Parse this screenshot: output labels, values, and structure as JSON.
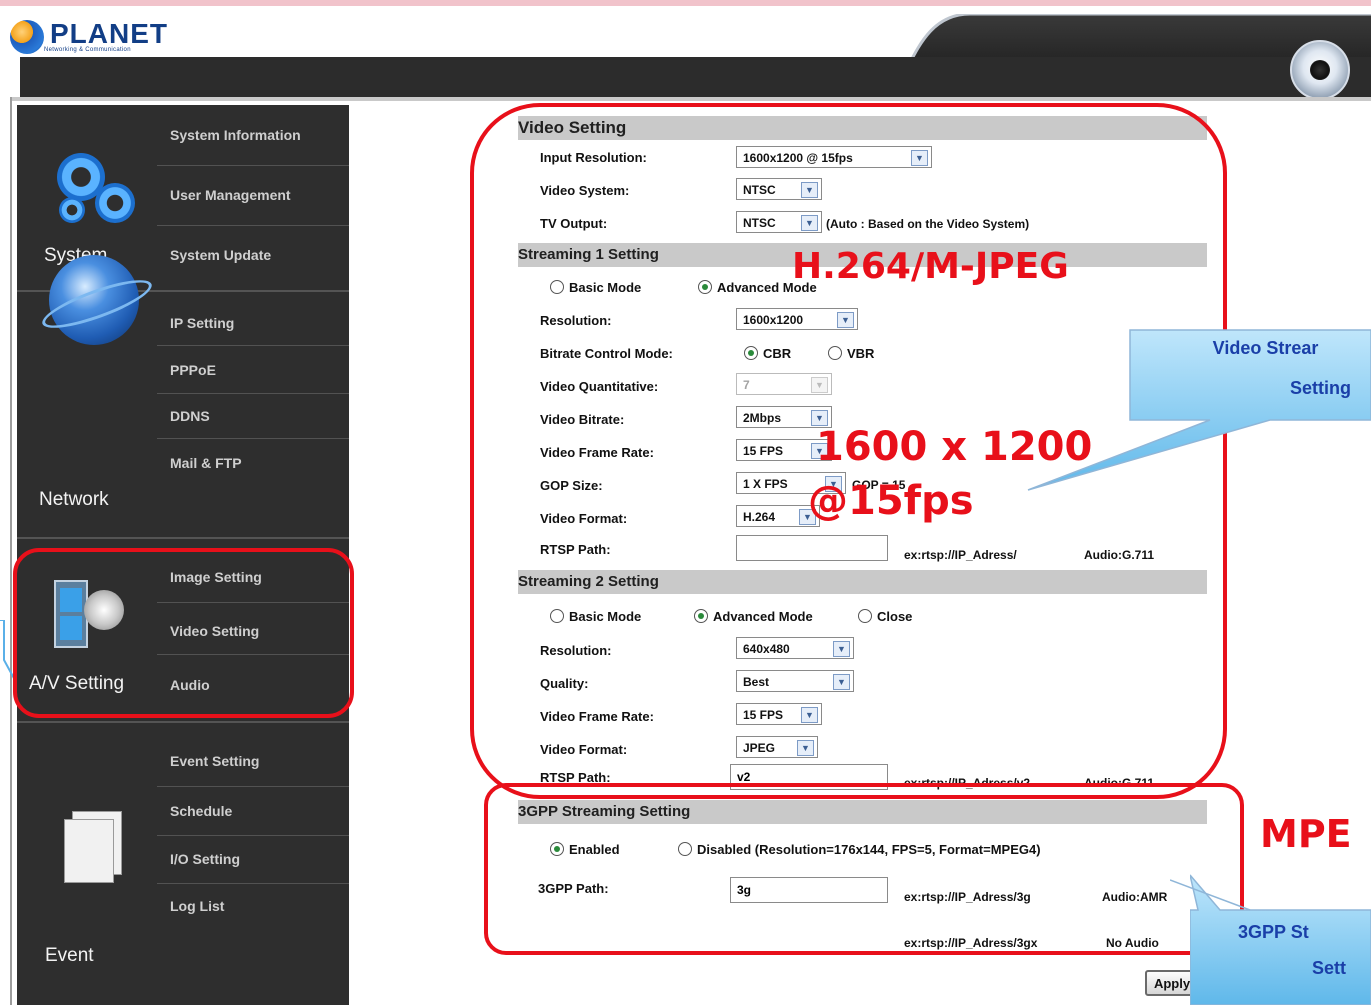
{
  "header": {
    "brand": "PLANET",
    "brand_sub": "Networking & Communication"
  },
  "sidebar": {
    "groups": [
      {
        "label": "System",
        "items": [
          "System Information",
          "User Management",
          "System Update"
        ]
      },
      {
        "label": "Network",
        "items": [
          "IP Setting",
          "PPPoE",
          "DDNS",
          "Mail & FTP"
        ]
      },
      {
        "label": "A/V Setting",
        "items": [
          "Image Setting",
          "Video Setting",
          "Audio"
        ]
      },
      {
        "label": "Event",
        "items": [
          "Event Setting",
          "Schedule",
          "I/O Setting",
          "Log List"
        ]
      }
    ]
  },
  "video_setting": {
    "title": "Video Setting",
    "input_resolution": {
      "label": "Input Resolution:",
      "value": "1600x1200 @ 15fps"
    },
    "video_system": {
      "label": "Video System:",
      "value": "NTSC"
    },
    "tv_output": {
      "label": "TV Output:",
      "value": "NTSC",
      "note": "(Auto : Based on the Video System)"
    }
  },
  "streaming1": {
    "title": "Streaming 1 Setting",
    "mode_basic": "Basic Mode",
    "mode_advanced": "Advanced Mode",
    "resolution": {
      "label": "Resolution:",
      "value": "1600x1200"
    },
    "bitrate_mode": {
      "label": "Bitrate Control Mode:",
      "cbr": "CBR",
      "vbr": "VBR"
    },
    "quantitative": {
      "label": "Video Quantitative:",
      "value": "7"
    },
    "bitrate": {
      "label": "Video Bitrate:",
      "value": "2Mbps"
    },
    "frame_rate": {
      "label": "Video Frame Rate:",
      "value": "15 FPS"
    },
    "gop": {
      "label": "GOP Size:",
      "value": "1 X FPS",
      "note": "GOP = 15"
    },
    "format": {
      "label": "Video Format:",
      "value": "H.264"
    },
    "rtsp": {
      "label": "RTSP Path:",
      "value": "",
      "note": "ex:rtsp://IP_Adress/",
      "audio": "Audio:G.711"
    }
  },
  "streaming2": {
    "title": "Streaming 2 Setting",
    "mode_basic": "Basic Mode",
    "mode_advanced": "Advanced Mode",
    "mode_close": "Close",
    "resolution": {
      "label": "Resolution:",
      "value": "640x480"
    },
    "quality": {
      "label": "Quality:",
      "value": "Best"
    },
    "frame_rate": {
      "label": "Video Frame Rate:",
      "value": "15 FPS"
    },
    "format": {
      "label": "Video Format:",
      "value": "JPEG"
    },
    "rtsp": {
      "label": "RTSP Path:",
      "value": "v2",
      "note": "ex:rtsp://IP_Adress/v2",
      "audio": "Audio:G.711"
    }
  },
  "gpp": {
    "title": "3GPP Streaming Setting",
    "enabled": "Enabled",
    "disabled": "Disabled (Resolution=176x144, FPS=5, Format=MPEG4)",
    "path": {
      "label": "3GPP Path:",
      "value": "3g",
      "note": "ex:rtsp://IP_Adress/3g",
      "audio": "Audio:AMR"
    },
    "note2": "ex:rtsp://IP_Adress/3gx",
    "note2_audio": "No Audio"
  },
  "apply_label": "Apply",
  "annotations": {
    "codec": "H.264/M-JPEG",
    "res_line1": "1600 x 1200",
    "res_line2": "@15fps",
    "mpeg": "MPE",
    "callout_video_line1": "Video Strear",
    "callout_video_line2": "Setting",
    "callout_3gpp_line1": "3GPP St",
    "callout_3gpp_line2": "Sett"
  },
  "colors": {
    "highlight_red": "#e8101a",
    "callout_blue": "#6cc0ec",
    "sidebar_bg": "#2e2e2e"
  }
}
